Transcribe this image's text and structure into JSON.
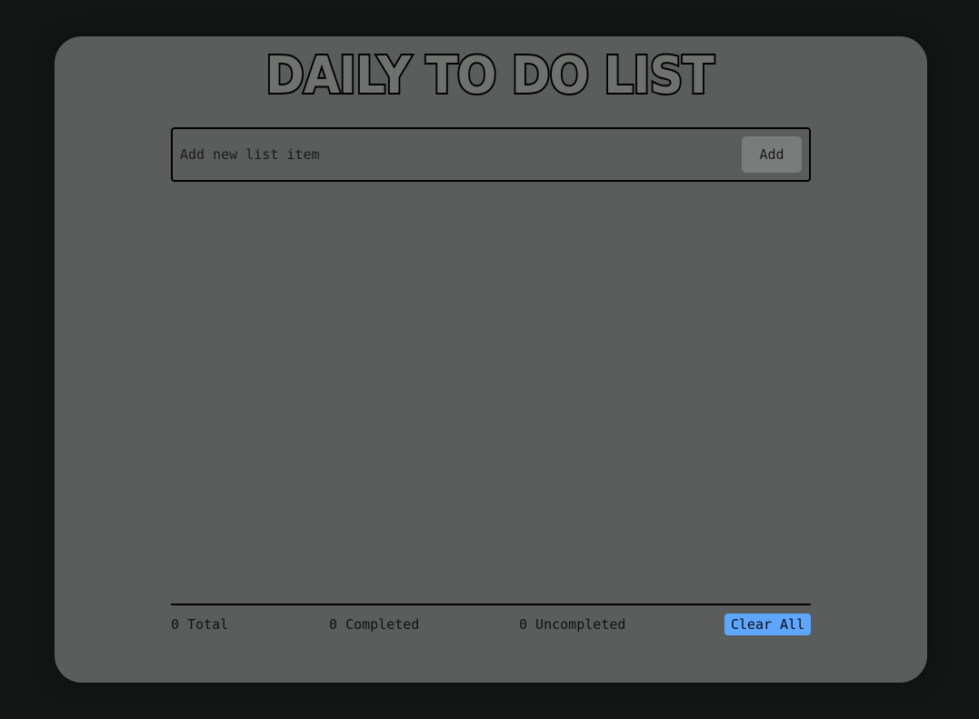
{
  "app": {
    "title": "DAILY TO DO LIST"
  },
  "new_item": {
    "placeholder": "Add new list item",
    "value": "",
    "add_label": "Add"
  },
  "items": [],
  "stats": {
    "total": "0 Total",
    "completed": "0 Completed",
    "uncompleted": "0 Uncompleted"
  },
  "actions": {
    "clear_all_label": "Clear All"
  },
  "colors": {
    "background": "#141616",
    "card": "#5b5d5c",
    "add_button": "#7a7b7b",
    "clear_button": "#5ea6ff"
  }
}
